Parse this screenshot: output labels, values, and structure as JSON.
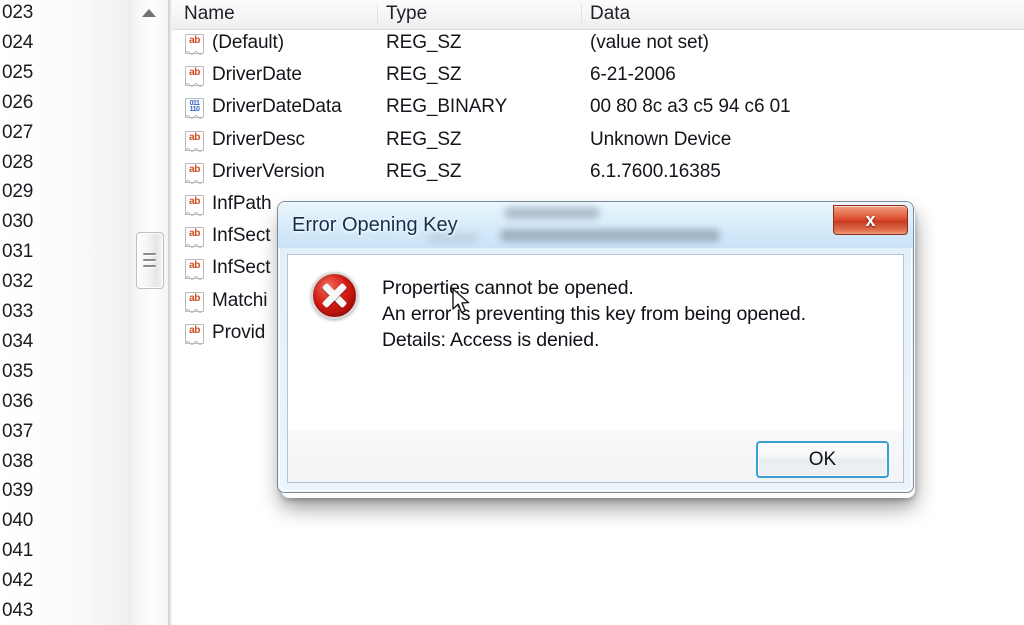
{
  "app": {
    "name": "Registry Editor"
  },
  "tree_pane": {
    "items": [
      {
        "label": "023"
      },
      {
        "label": "024"
      },
      {
        "label": "025"
      },
      {
        "label": "026"
      },
      {
        "label": "027"
      },
      {
        "label": "028"
      },
      {
        "label": "029"
      },
      {
        "label": "030"
      },
      {
        "label": "031"
      },
      {
        "label": "032"
      },
      {
        "label": "033"
      },
      {
        "label": "034"
      },
      {
        "label": "035"
      },
      {
        "label": "036"
      },
      {
        "label": "037"
      },
      {
        "label": "038"
      },
      {
        "label": "039"
      },
      {
        "label": "040"
      },
      {
        "label": "041"
      },
      {
        "label": "042"
      },
      {
        "label": "043"
      }
    ]
  },
  "scrollbar": {
    "up_arrow_icon": "triangle-up-icon",
    "thumb_icon": "scrollbar-thumb-grip"
  },
  "list": {
    "columns": [
      "Name",
      "Type",
      "Data"
    ],
    "rows": [
      {
        "icon": "string-value-icon",
        "icon_text": "ab",
        "name": "(Default)",
        "type": "REG_SZ",
        "data": "(value not set)"
      },
      {
        "icon": "string-value-icon",
        "icon_text": "ab",
        "name": "DriverDate",
        "type": "REG_SZ",
        "data": "6-21-2006"
      },
      {
        "icon": "binary-value-icon",
        "icon_text": "011",
        "name": "DriverDateData",
        "type": "REG_BINARY",
        "data": "00 80 8c a3 c5 94 c6 01"
      },
      {
        "icon": "string-value-icon",
        "icon_text": "ab",
        "name": "DriverDesc",
        "type": "REG_SZ",
        "data": "Unknown Device"
      },
      {
        "icon": "string-value-icon",
        "icon_text": "ab",
        "name": "DriverVersion",
        "type": "REG_SZ",
        "data": "6.1.7600.16385"
      },
      {
        "icon": "string-value-icon",
        "icon_text": "ab",
        "name": "InfPath",
        "type": "",
        "data": ""
      },
      {
        "icon": "string-value-icon",
        "icon_text": "ab",
        "name": "InfSect",
        "type": "",
        "data": ""
      },
      {
        "icon": "string-value-icon",
        "icon_text": "ab",
        "name": "InfSect",
        "type": "",
        "data": ""
      },
      {
        "icon": "string-value-icon",
        "icon_text": "ab",
        "name": "Matchi",
        "type": "",
        "data": ""
      },
      {
        "icon": "string-value-icon",
        "icon_text": "ab",
        "name": "Provid",
        "type": "",
        "data": ""
      }
    ]
  },
  "dialog": {
    "title": "Error Opening Key",
    "close_label": "x",
    "error_icon": "error-circle-icon",
    "message_lines": [
      "Properties cannot be opened.",
      "An error is preventing this key from being opened.",
      "Details: Access is denied."
    ],
    "ok_label": "OK"
  },
  "cursor": {
    "icon": "arrow-cursor-icon"
  },
  "colors": {
    "error_red": "#d81f16",
    "close_button_red": "#d9472a",
    "focus_blue": "#3c9fd4",
    "title_text": "#13304f",
    "string_icon_orange": "#d2491b",
    "binary_icon_blue": "#2b5fc4"
  }
}
